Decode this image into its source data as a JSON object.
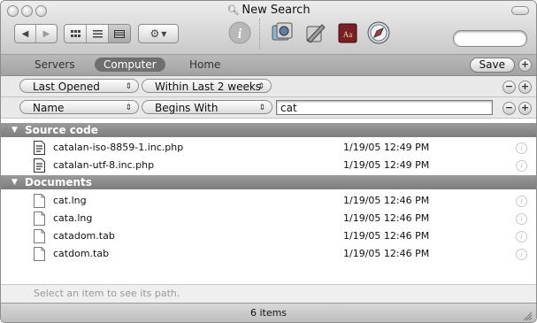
{
  "window": {
    "title": "New Search"
  },
  "toolbar": {
    "nav": [
      "back-arrow-icon",
      "forward-arrow-icon"
    ],
    "view_modes": [
      "icon-view-icon",
      "list-view-icon",
      "column-view-icon"
    ],
    "action": "gear-menu-icon",
    "info": "info-icon",
    "apps": [
      "preview-icon",
      "script-editor-icon",
      "dictionary-icon",
      "safari-icon"
    ]
  },
  "scope": {
    "tabs": [
      {
        "label": "Servers",
        "selected": false
      },
      {
        "label": "Computer",
        "selected": true
      },
      {
        "label": "Home",
        "selected": false
      }
    ],
    "save_label": "Save"
  },
  "criteria": [
    {
      "attribute": "Last Opened",
      "operator": "Within Last 2 weeks",
      "value": ""
    },
    {
      "attribute": "Name",
      "operator": "Begins With",
      "value": "cat"
    }
  ],
  "sections": [
    {
      "title": "Source code",
      "items": [
        {
          "name": "catalan-iso-8859-1.inc.php",
          "date": "1/19/05 12:49 PM"
        },
        {
          "name": "catalan-utf-8.inc.php",
          "date": "1/19/05 12:49 PM"
        }
      ]
    },
    {
      "title": "Documents",
      "items": [
        {
          "name": "cat.lng",
          "date": "1/19/05 12:46 PM"
        },
        {
          "name": "cata.lng",
          "date": "1/19/05 12:46 PM"
        },
        {
          "name": "catadom.tab",
          "date": "1/19/05 12:46 PM"
        },
        {
          "name": "catdom.tab",
          "date": "1/19/05 12:46 PM"
        }
      ]
    }
  ],
  "pathbar": {
    "hint": "Select an item to see its path."
  },
  "status": {
    "text": "6 items"
  },
  "colors": {
    "section_header": "#7d7d7d",
    "scope_selected": "#6f6f6f",
    "info_blue": "#4a86d8"
  }
}
